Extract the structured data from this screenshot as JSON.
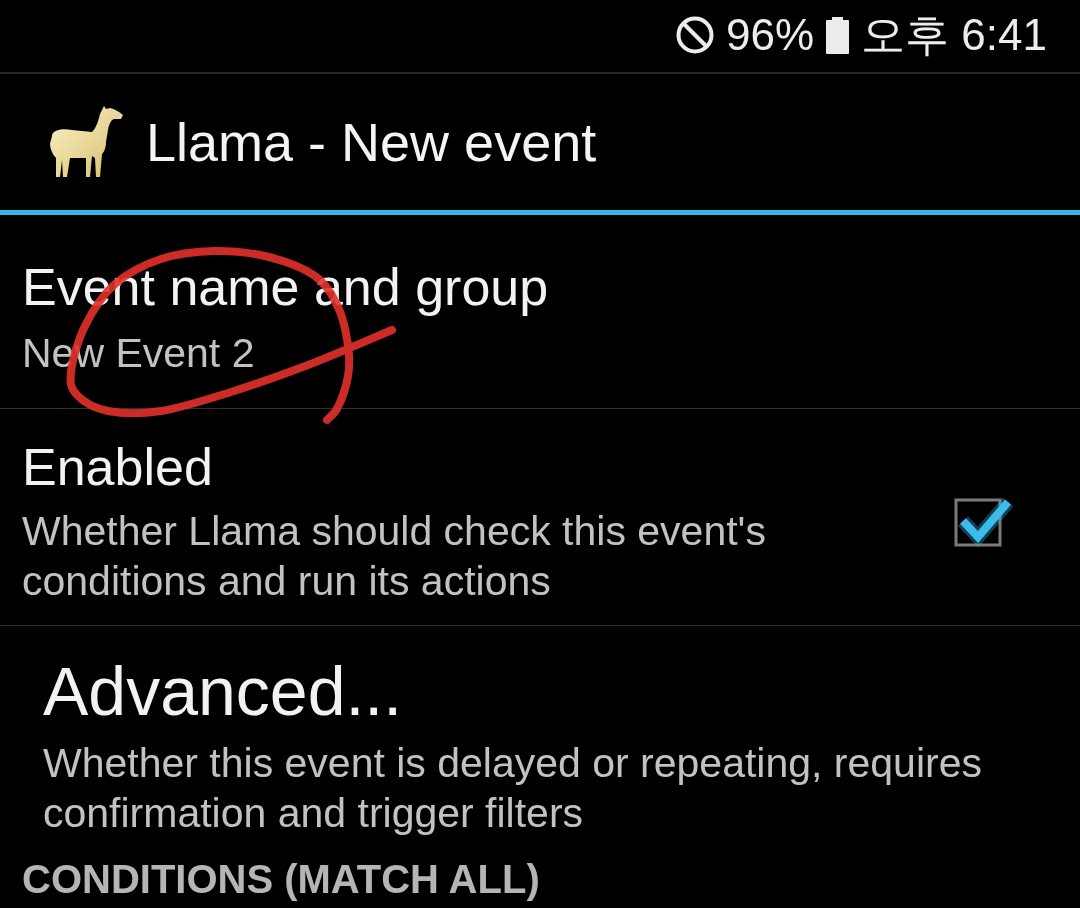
{
  "status_bar": {
    "battery": "96%",
    "time": "오후 6:41"
  },
  "action_bar": {
    "title": "Llama - New event"
  },
  "preferences": [
    {
      "kind": "edit",
      "title": "Event name and group",
      "summary": "New Event 2"
    },
    {
      "kind": "checkbox",
      "title": "Enabled",
      "summary": "Whether Llama should check this event's conditions and run its actions",
      "checked": true
    },
    {
      "kind": "screen",
      "title": "Advanced...",
      "summary": "Whether this event is delayed or repeating, requires confirmation and trigger filters"
    }
  ],
  "section_header": "CONDITIONS (MATCH ALL)"
}
